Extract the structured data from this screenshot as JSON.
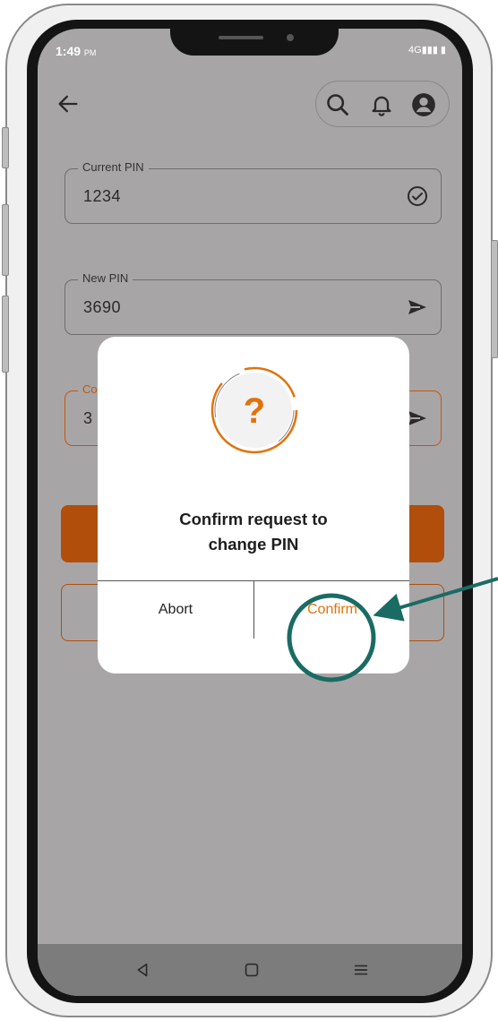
{
  "status_bar": {
    "time": "1:49",
    "time_suffix": "PM",
    "network": "4G"
  },
  "header": {
    "back_icon": "arrow-left-icon",
    "search_icon": "search-icon",
    "bell_icon": "bell-icon",
    "profile_icon": "profile-icon"
  },
  "form": {
    "current_pin": {
      "label": "Current PIN",
      "value": "1234",
      "icon": "check-circle-icon"
    },
    "new_pin": {
      "label": "New PIN",
      "value": "3690",
      "icon": "send-icon"
    },
    "confirm_pin": {
      "label": "Co",
      "value": "3",
      "icon": "send-icon"
    }
  },
  "dialog": {
    "icon": "question-icon",
    "icon_glyph": "?",
    "message_line1": "Confirm request to",
    "message_line2": "change PIN",
    "abort_label": "Abort",
    "confirm_label": "Confirm"
  },
  "navbar": {
    "back": "nav-back-icon",
    "home": "nav-home-icon",
    "menu": "nav-menu-icon"
  },
  "colors": {
    "accent": "#e2720c",
    "primary_button": "#b14e0c",
    "annotation": "#1a6b63",
    "screen_overlay": "#a8a5a6"
  }
}
